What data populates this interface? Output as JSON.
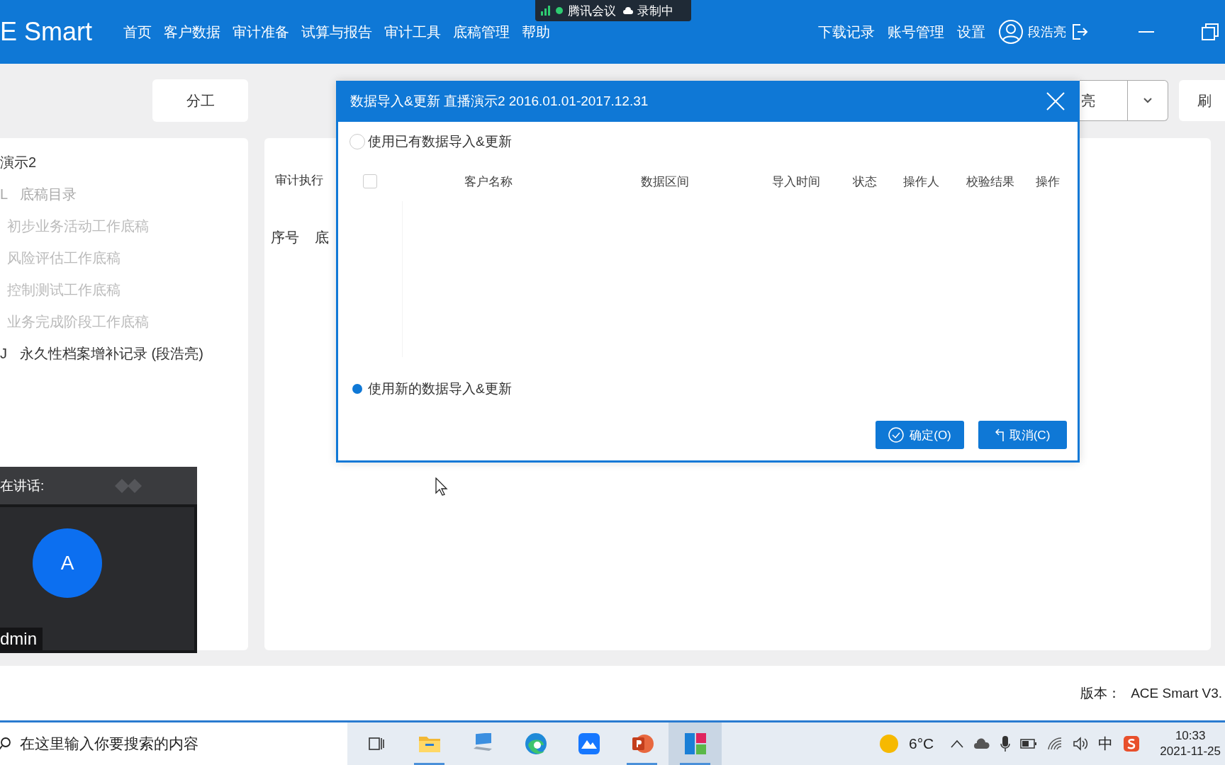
{
  "meeting_indicator": {
    "app": "腾讯会议",
    "recording": "录制中"
  },
  "app_bar": {
    "logo": "E Smart",
    "nav": [
      "首页",
      "客户数据",
      "审计准备",
      "试算与报告",
      "审计工具",
      "底稿管理",
      "帮助"
    ],
    "links": [
      "下载记录",
      "账号管理",
      "设置"
    ],
    "user": "段浩亮"
  },
  "toolbar": {
    "tab": "分工",
    "dropdown_value": "亮",
    "button": "刷"
  },
  "tree": {
    "root": "演示2",
    "items": [
      {
        "code": "L",
        "label": "底稿目录",
        "children": [
          {
            "label": "初步业务活动工作底稿"
          },
          {
            "label": "风险评估工作底稿"
          },
          {
            "label": "控制测试工作底稿"
          },
          {
            "label": "业务完成阶段工作底稿"
          }
        ]
      },
      {
        "code": "J",
        "label": "永久性档案增补记录 (段浩亮)"
      }
    ]
  },
  "main": {
    "heading": "审计执行",
    "columns": [
      "序号",
      "底"
    ]
  },
  "dialog": {
    "title": "数据导入&更新 直播演示2 2016.01.01-2017.12.31",
    "options": [
      {
        "label": "使用已有数据导入&更新",
        "selected": false
      },
      {
        "label": "使用新的数据导入&更新",
        "selected": true
      }
    ],
    "table": {
      "select_all_checked": false,
      "columns": [
        "客户名称",
        "数据区间",
        "导入时间",
        "状态",
        "操作人",
        "校验结果",
        "操作"
      ]
    },
    "buttons": [
      {
        "kind": "confirm",
        "label": "确定(O)"
      },
      {
        "kind": "cancel",
        "label": "取消(C)"
      }
    ]
  },
  "speaker_tile": {
    "caption": "在讲话:",
    "avatar_letter": "A",
    "name": "dmin"
  },
  "footer": {
    "version_label": "版本：",
    "version": "ACE Smart V3."
  },
  "taskbar": {
    "search_placeholder": "在这里输入你要搜索的内容",
    "apps": [
      {
        "kind": "task-view",
        "running": false,
        "selected": false
      },
      {
        "kind": "folder",
        "running": true,
        "selected": false
      },
      {
        "kind": "computer",
        "running": false,
        "selected": false
      },
      {
        "kind": "browser",
        "running": false,
        "selected": false
      },
      {
        "kind": "meeting",
        "running": false,
        "selected": false
      },
      {
        "kind": "presentation",
        "running": true,
        "selected": false
      },
      {
        "kind": "tiles",
        "running": true,
        "selected": true
      }
    ],
    "weather": "6°C",
    "ime": "中",
    "time": "10:33",
    "date": "2021-11-25"
  }
}
